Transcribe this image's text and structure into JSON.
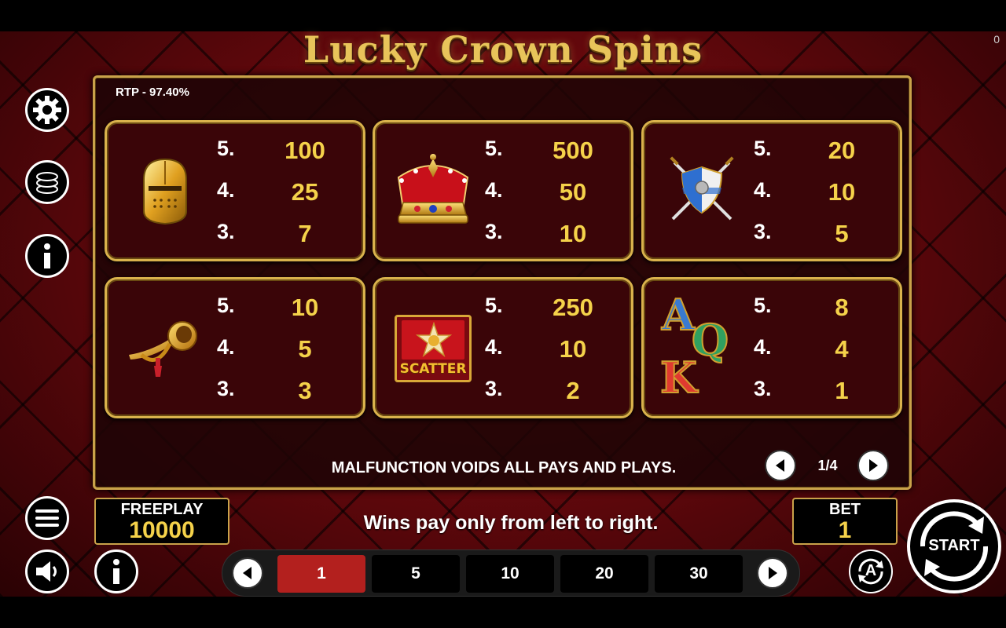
{
  "header": {
    "title": "Lucky Crown Spins",
    "corner_counter": "0"
  },
  "paytable": {
    "rtp": "RTP - 97.40%",
    "symbols": [
      {
        "icon": "knight-helmet-icon",
        "pays": [
          {
            "count": "5.",
            "value": "100"
          },
          {
            "count": "4.",
            "value": "25"
          },
          {
            "count": "3.",
            "value": "7"
          }
        ]
      },
      {
        "icon": "royal-crown-icon",
        "pays": [
          {
            "count": "5.",
            "value": "500"
          },
          {
            "count": "4.",
            "value": "50"
          },
          {
            "count": "3.",
            "value": "10"
          }
        ]
      },
      {
        "icon": "shield-swords-icon",
        "pays": [
          {
            "count": "5.",
            "value": "20"
          },
          {
            "count": "4.",
            "value": "10"
          },
          {
            "count": "3.",
            "value": "5"
          }
        ]
      },
      {
        "icon": "horn-icon",
        "pays": [
          {
            "count": "5.",
            "value": "10"
          },
          {
            "count": "4.",
            "value": "5"
          },
          {
            "count": "3.",
            "value": "3"
          }
        ]
      },
      {
        "icon": "scatter-icon",
        "label": "SCATTER",
        "pays": [
          {
            "count": "5.",
            "value": "250"
          },
          {
            "count": "4.",
            "value": "10"
          },
          {
            "count": "3.",
            "value": "2"
          }
        ]
      },
      {
        "icon": "aqk-letters-icon",
        "letters": [
          "A",
          "Q",
          "K"
        ],
        "pays": [
          {
            "count": "5.",
            "value": "8"
          },
          {
            "count": "4.",
            "value": "4"
          },
          {
            "count": "3.",
            "value": "1"
          }
        ]
      }
    ],
    "malfunction_text": "MALFUNCTION VOIDS ALL PAYS AND PLAYS.",
    "page": "1/4"
  },
  "footer": {
    "freeplay_label": "FREEPLAY",
    "freeplay_value": "10000",
    "bet_label": "BET",
    "bet_value": "1",
    "wins_text": "Wins pay only from left to right.",
    "bet_options": [
      "1",
      "5",
      "10",
      "20",
      "30"
    ],
    "selected_bet": "1",
    "start_label": "START",
    "autoplay_letter": "A"
  },
  "colors": {
    "gold": "#c9a24a",
    "value_yellow": "#f5d24a",
    "selected_bet": "#b3201e",
    "card_bg": "#3a0508"
  }
}
